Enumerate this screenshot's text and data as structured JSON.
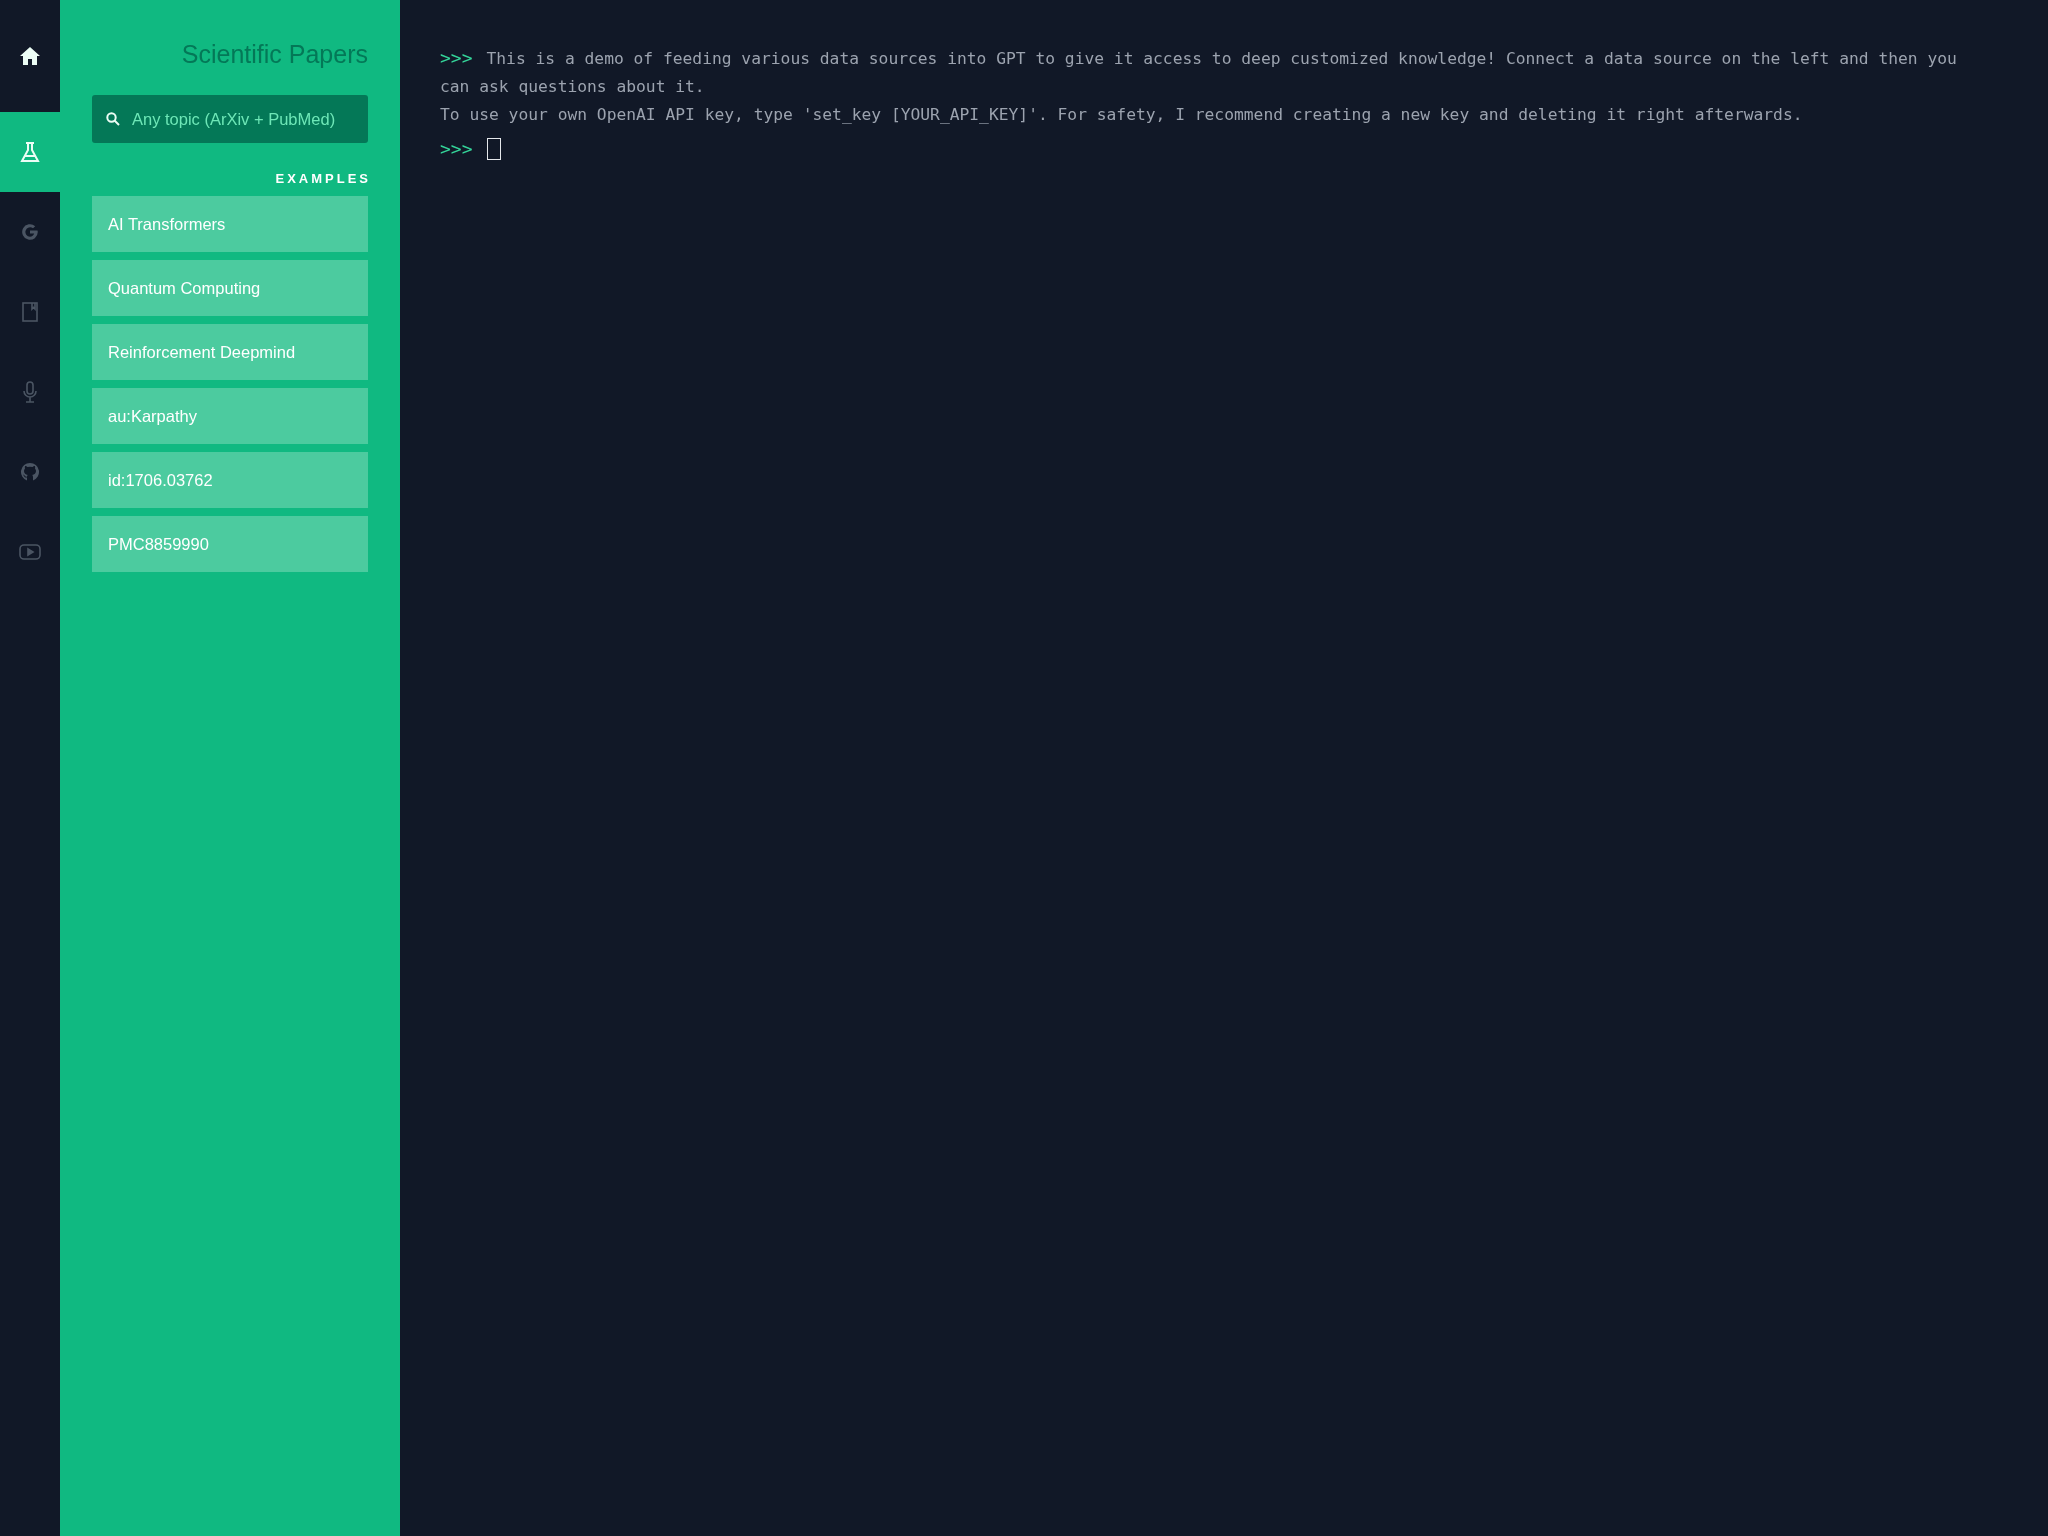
{
  "nav": [
    {
      "kind": "home",
      "selected": false
    },
    {
      "kind": "flask",
      "selected": true
    },
    {
      "kind": "google",
      "selected": false
    },
    {
      "kind": "book",
      "selected": false
    },
    {
      "kind": "mic",
      "selected": false
    },
    {
      "kind": "github",
      "selected": false
    },
    {
      "kind": "youtube",
      "selected": false
    }
  ],
  "panel": {
    "title": "Scientific Papers",
    "search": {
      "placeholder": "Any topic (ArXiv + PubMed)"
    },
    "examples_heading": "EXAMPLES",
    "examples": [
      "AI Transformers",
      "Quantum Computing",
      "Reinforcement Deepmind",
      "au:Karpathy",
      "id:1706.03762",
      "PMC8859990"
    ]
  },
  "terminal": {
    "lines": [
      {
        "prompt": ">>>",
        "text": "This is a demo of feeding various data sources into GPT to give it access to deep customized knowledge! Connect a data source on the left and then you"
      },
      {
        "text": "can ask questions about it."
      },
      {
        "text": "To use your own OpenAI API key, type 'set_key [YOUR_API_KEY]'. For safety, I recommend creating a new key and deleting it right afterwards."
      }
    ],
    "input": {
      "prompt": ">>>"
    }
  }
}
